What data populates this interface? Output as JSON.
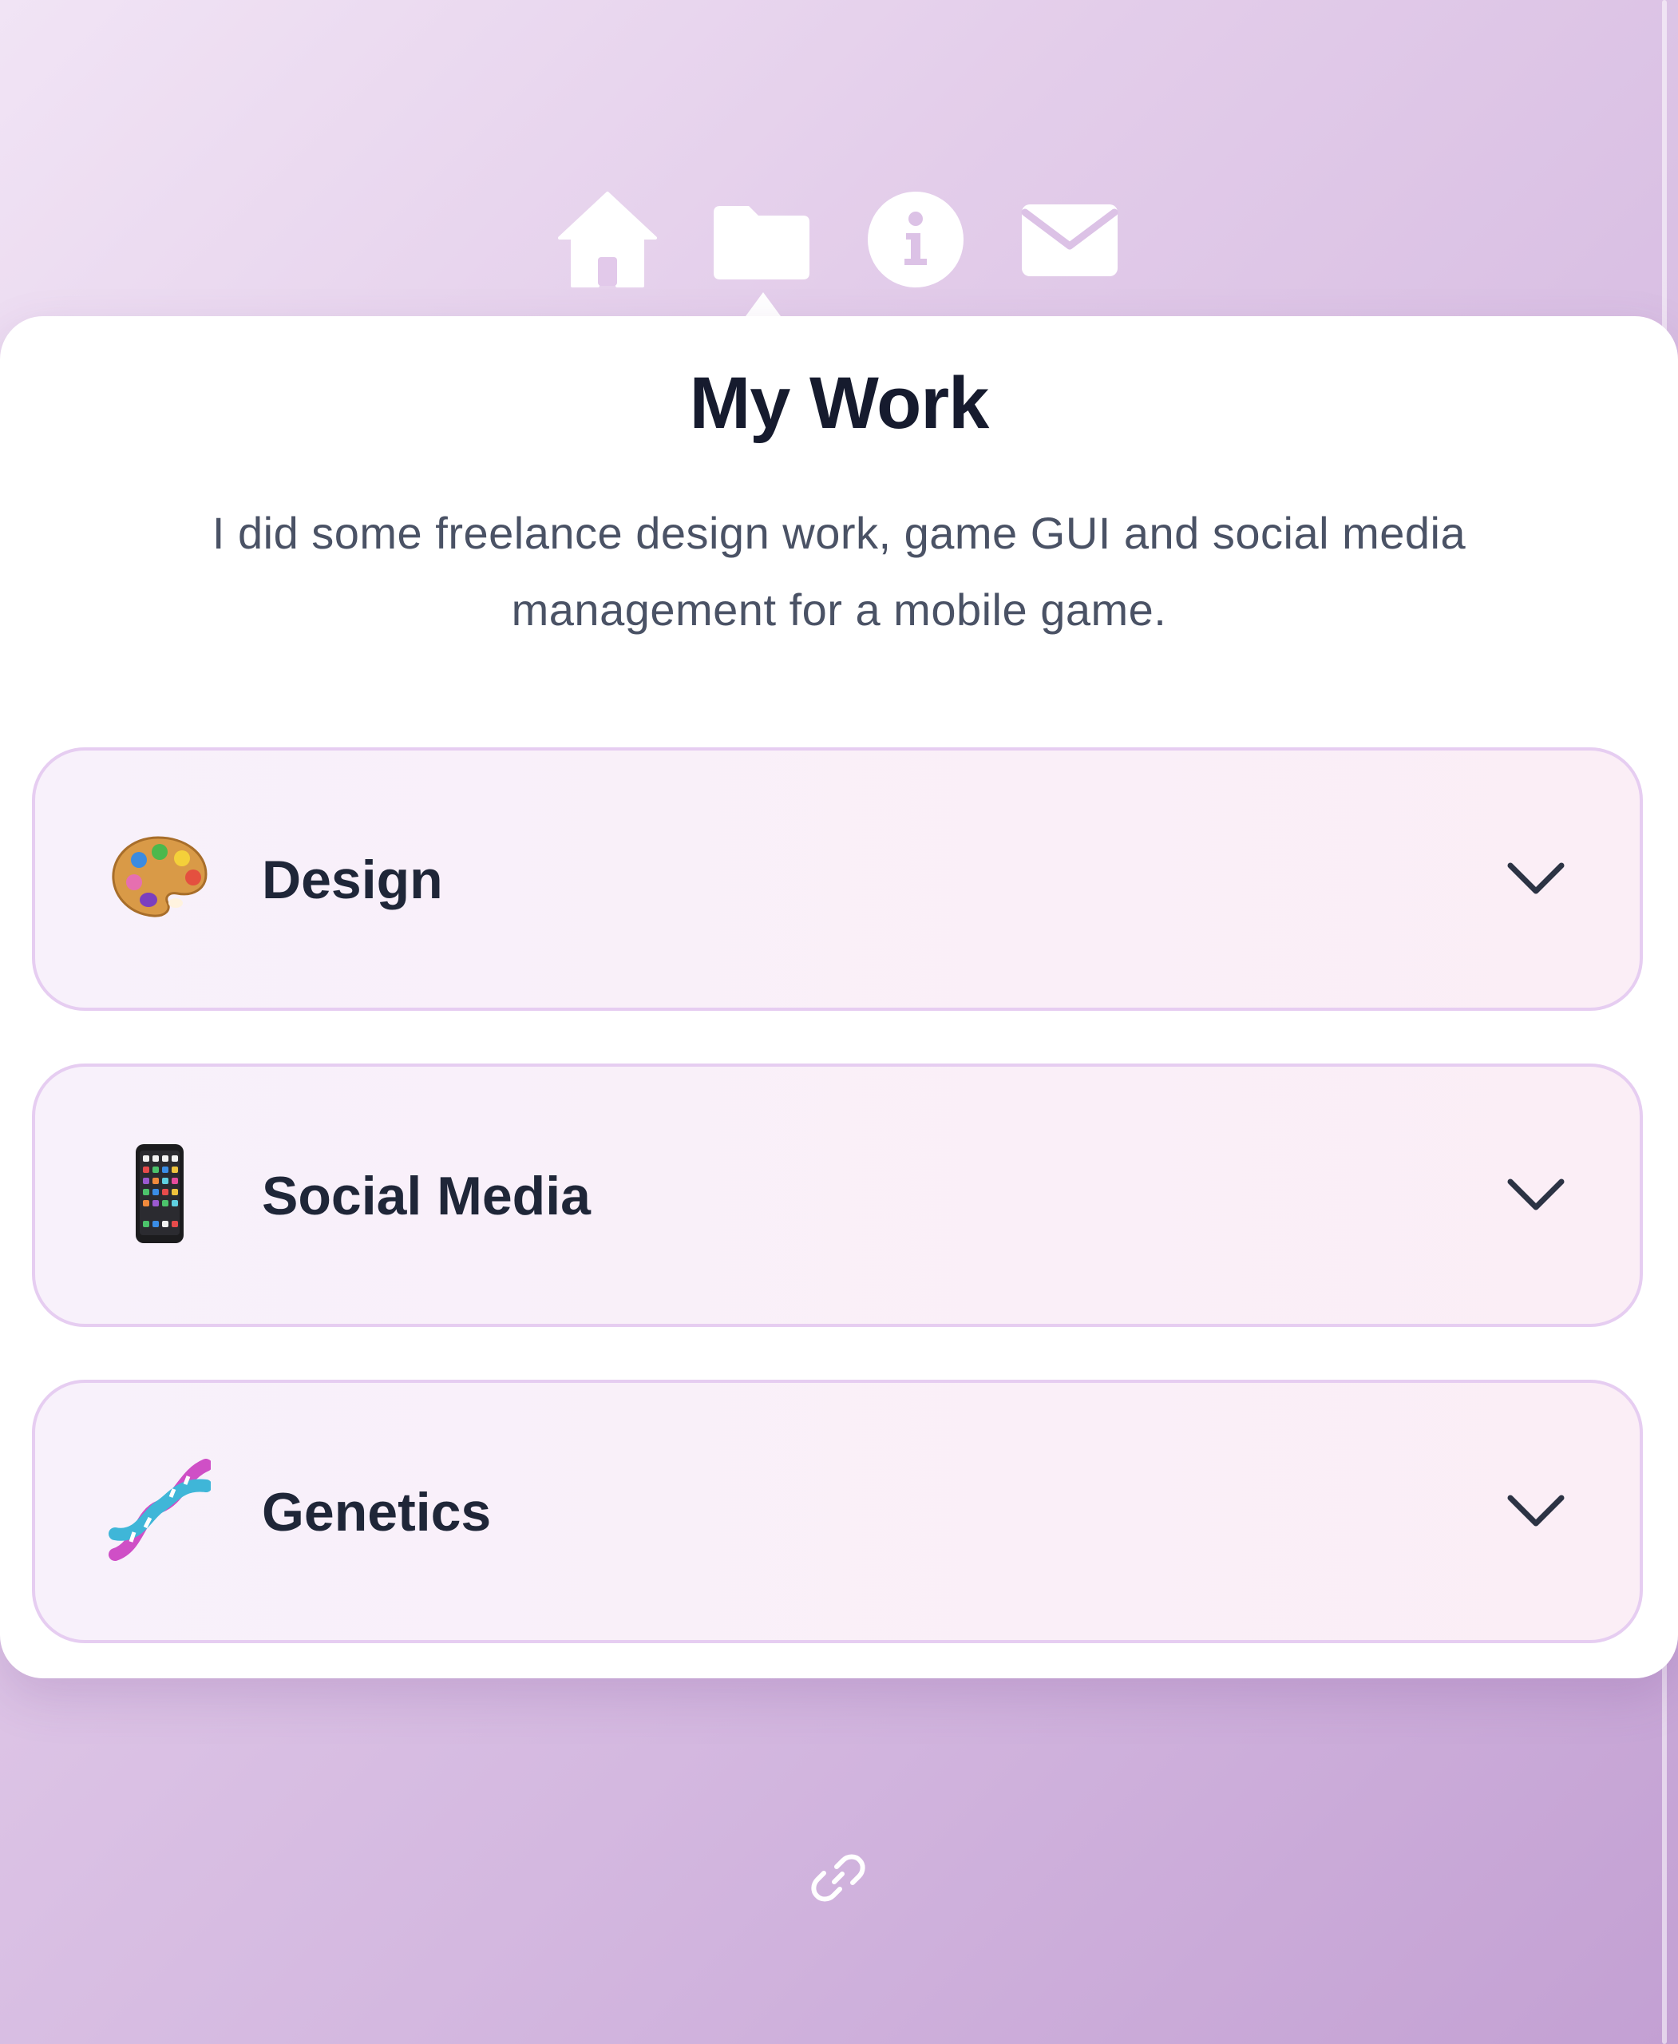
{
  "nav": {
    "items": [
      {
        "icon": "home-icon",
        "label": "Home"
      },
      {
        "icon": "folder-icon",
        "label": "Work"
      },
      {
        "icon": "info-icon",
        "label": "About"
      },
      {
        "icon": "envelope-icon",
        "label": "Contact"
      }
    ],
    "active_index": 1
  },
  "section": {
    "title": "My Work",
    "description": "I did some freelance design work, game GUI and social media management for a mobile game."
  },
  "accordion": {
    "items": [
      {
        "icon": "artist-palette-icon",
        "label": "Design",
        "expanded": false
      },
      {
        "icon": "mobile-phone-icon",
        "label": "Social Media",
        "expanded": false
      },
      {
        "icon": "dna-icon",
        "label": "Genetics",
        "expanded": false
      }
    ]
  },
  "footer": {
    "icon": "link-icon"
  },
  "colors": {
    "background_start": "#f1e4f5",
    "background_end": "#c3a0d3",
    "card": "#ffffff",
    "title": "#161b2e",
    "body_text": "#4a5265",
    "accordion_border": "#e6cdf1",
    "accordion_fill": "#f8f1fb"
  }
}
